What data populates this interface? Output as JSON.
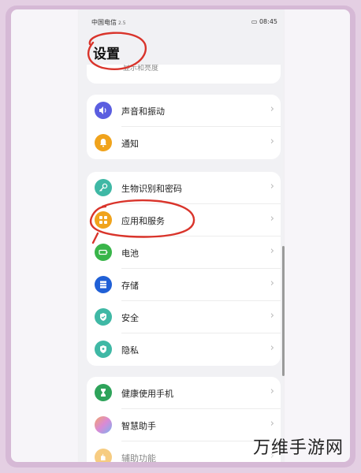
{
  "status_bar": {
    "carrier": "中国电信",
    "signal": "2.5",
    "time": "08:45"
  },
  "page_title": "设置",
  "cut_off_item": "显示和亮度",
  "groups": [
    {
      "items": [
        {
          "label": "声音和振动",
          "icon": "speaker-icon",
          "color": "#5b5ee0"
        },
        {
          "label": "通知",
          "icon": "bell-icon",
          "color": "#f0a31c"
        }
      ]
    },
    {
      "items": [
        {
          "label": "生物识别和密码",
          "icon": "key-icon",
          "color": "#3fb8a5"
        },
        {
          "label": "应用和服务",
          "icon": "apps-icon",
          "color": "#f0a31c"
        },
        {
          "label": "电池",
          "icon": "battery-icon",
          "color": "#39b54a"
        },
        {
          "label": "存储",
          "icon": "storage-icon",
          "color": "#2060d6"
        },
        {
          "label": "安全",
          "icon": "shield-icon",
          "color": "#3fb8a5"
        },
        {
          "label": "隐私",
          "icon": "privacy-icon",
          "color": "#3fb8a5"
        }
      ]
    },
    {
      "items": [
        {
          "label": "健康使用手机",
          "icon": "hourglass-icon",
          "color": "#2ea35a"
        },
        {
          "label": "智慧助手",
          "icon": "assistant-icon",
          "color": "#e8a0d0"
        },
        {
          "label": "辅助功能",
          "icon": "accessibility-icon",
          "color": "#f0a31c"
        }
      ]
    }
  ],
  "watermark": "万维手游网",
  "annotation_color": "#d9342b"
}
